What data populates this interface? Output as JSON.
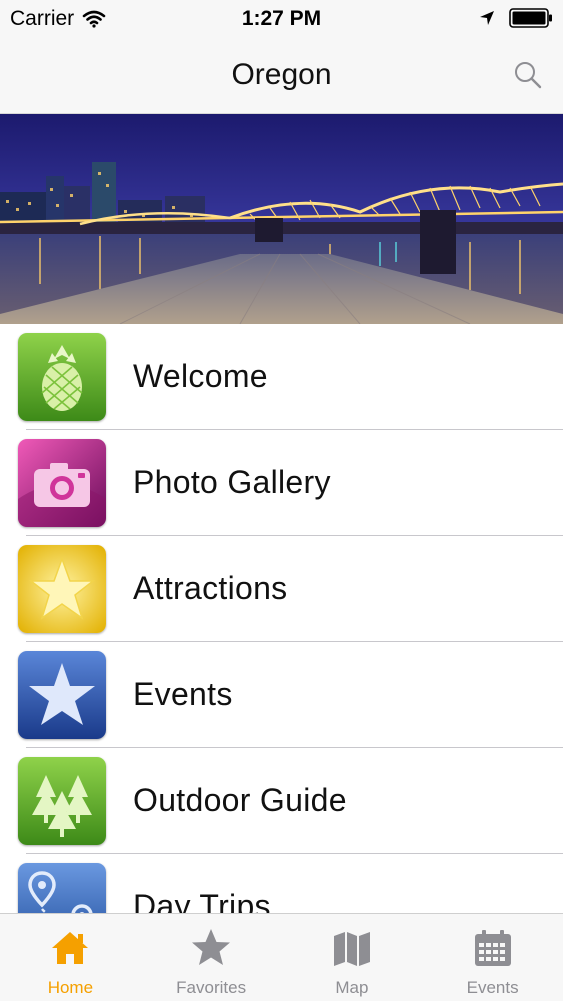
{
  "status_bar": {
    "carrier": "Carrier",
    "time": "1:27 PM"
  },
  "nav": {
    "title": "Oregon"
  },
  "menu": [
    {
      "label": "Welcome",
      "icon": "pineapple-icon",
      "color": "#5aa426"
    },
    {
      "label": "Photo Gallery",
      "icon": "camera-icon",
      "color": "#b0177a"
    },
    {
      "label": "Attractions",
      "icon": "star-icon",
      "color": "#f0c400"
    },
    {
      "label": "Events",
      "icon": "star-icon",
      "color": "#2a4fa8"
    },
    {
      "label": "Outdoor Guide",
      "icon": "trees-icon",
      "color": "#4f9a2a"
    },
    {
      "label": "Day Trips",
      "icon": "route-map-icon",
      "color": "#3a6fc0"
    }
  ],
  "tabs": [
    {
      "label": "Home",
      "icon": "home-icon",
      "active": true
    },
    {
      "label": "Favorites",
      "icon": "star-icon",
      "active": false
    },
    {
      "label": "Map",
      "icon": "map-icon",
      "active": false
    },
    {
      "label": "Events",
      "icon": "calendar-icon",
      "active": false
    }
  ],
  "colors": {
    "accent": "#f5a000",
    "inactive": "#8e8e93"
  }
}
